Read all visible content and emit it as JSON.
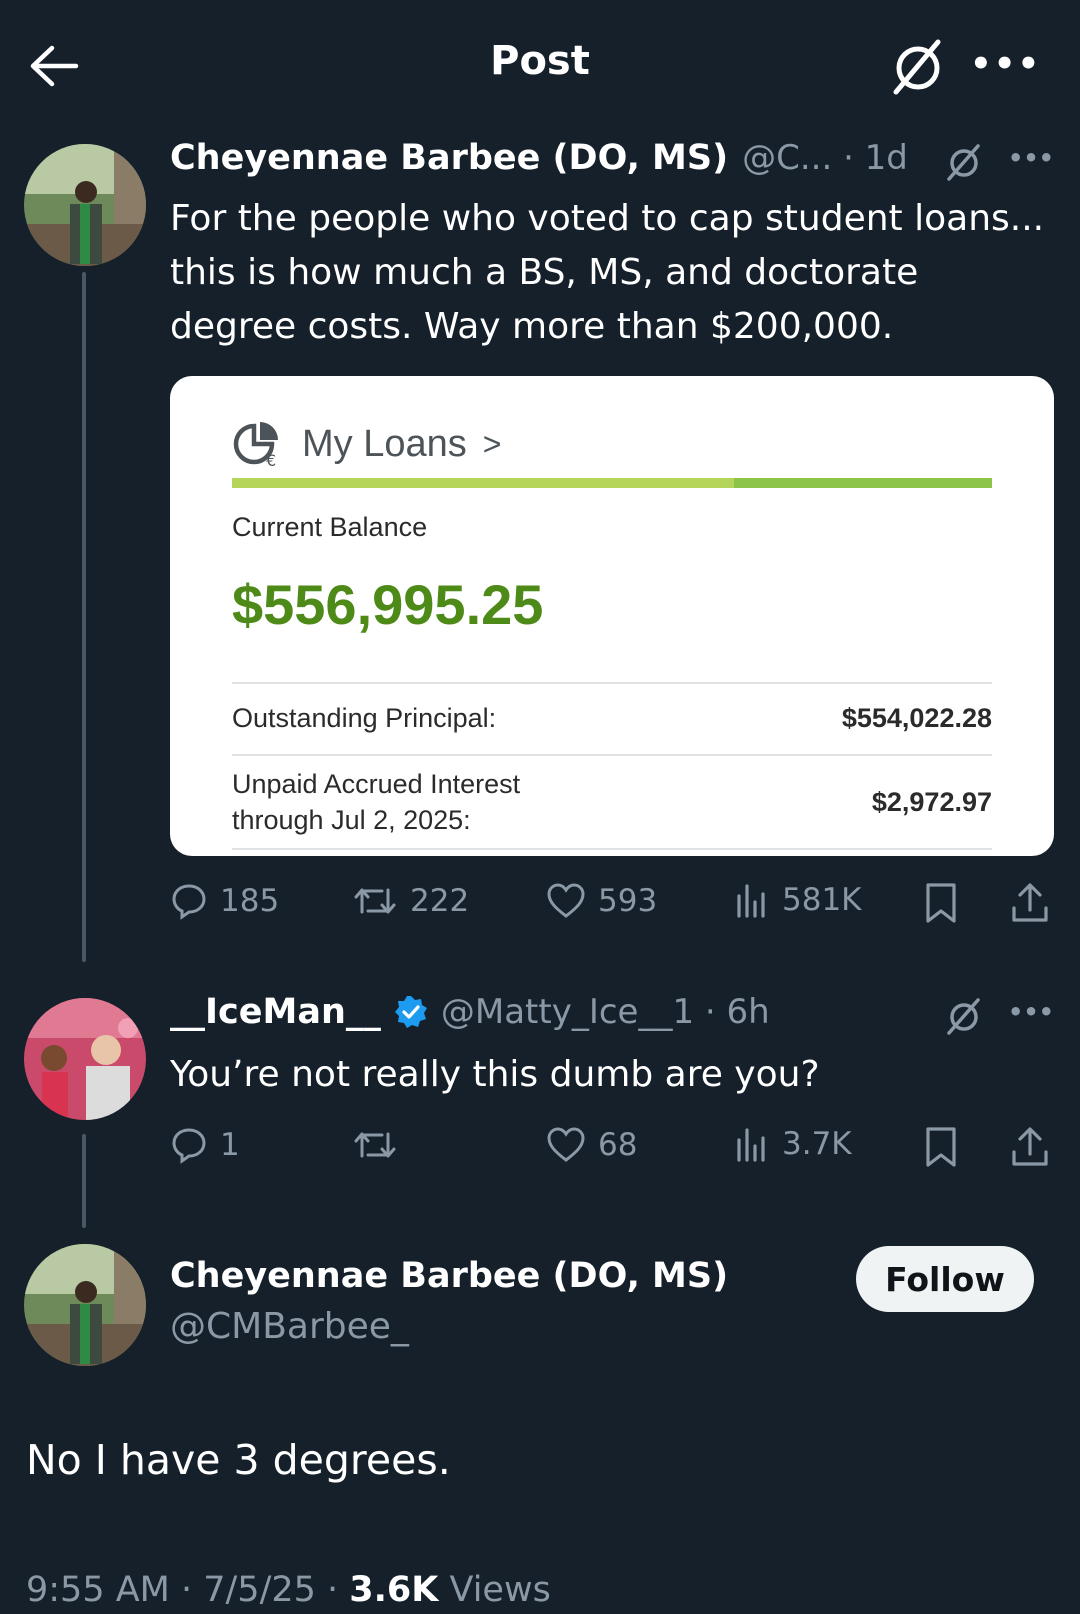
{
  "header": {
    "title": "Post",
    "grok_icon": "grok-icon",
    "more_icon": "more-icon",
    "more_label": "•••"
  },
  "tweet1": {
    "name": "Cheyennae Barbee (DO, MS)",
    "handle_time": "@C... · 1d",
    "more_label": "•••",
    "lines": [
      "For the people who voted to cap student loans...",
      "this is how much a BS, MS, and doctorate",
      "degree costs. Way more than $200,000."
    ],
    "card": {
      "title": "My Loans",
      "chevron": ">",
      "progress_fraction": 0.66,
      "balance_label": "Current Balance",
      "balance": "$556,995.25",
      "principal_label": "Outstanding Principal:",
      "principal_value": "$554,022.28",
      "interest_label_line1": "Unpaid Accrued Interest",
      "interest_label_line2": "through Jul 2, 2025:",
      "interest_value": "$2,972.97",
      "accent_color": "#4e8a18"
    },
    "actions": {
      "replies": "185",
      "reposts": "222",
      "likes": "593",
      "views": "581K"
    }
  },
  "tweet2": {
    "name": "__IceMan__",
    "handle_time": "@Matty_Ice__1 · 6h",
    "more_label": "•••",
    "text": "You’re not really this dumb are you?",
    "actions": {
      "replies": "1",
      "reposts": "",
      "likes": "68",
      "views": "3.7K"
    },
    "verified_color": "#1d9bf0"
  },
  "main": {
    "name": "Cheyennae Barbee (DO, MS)",
    "handle": "@CMBarbee_",
    "follow_label": "Follow",
    "text": "No I have 3 degrees.",
    "time": "9:55 AM · 7/5/25 · ",
    "views_count": "3.6K",
    "views_label": " Views"
  }
}
